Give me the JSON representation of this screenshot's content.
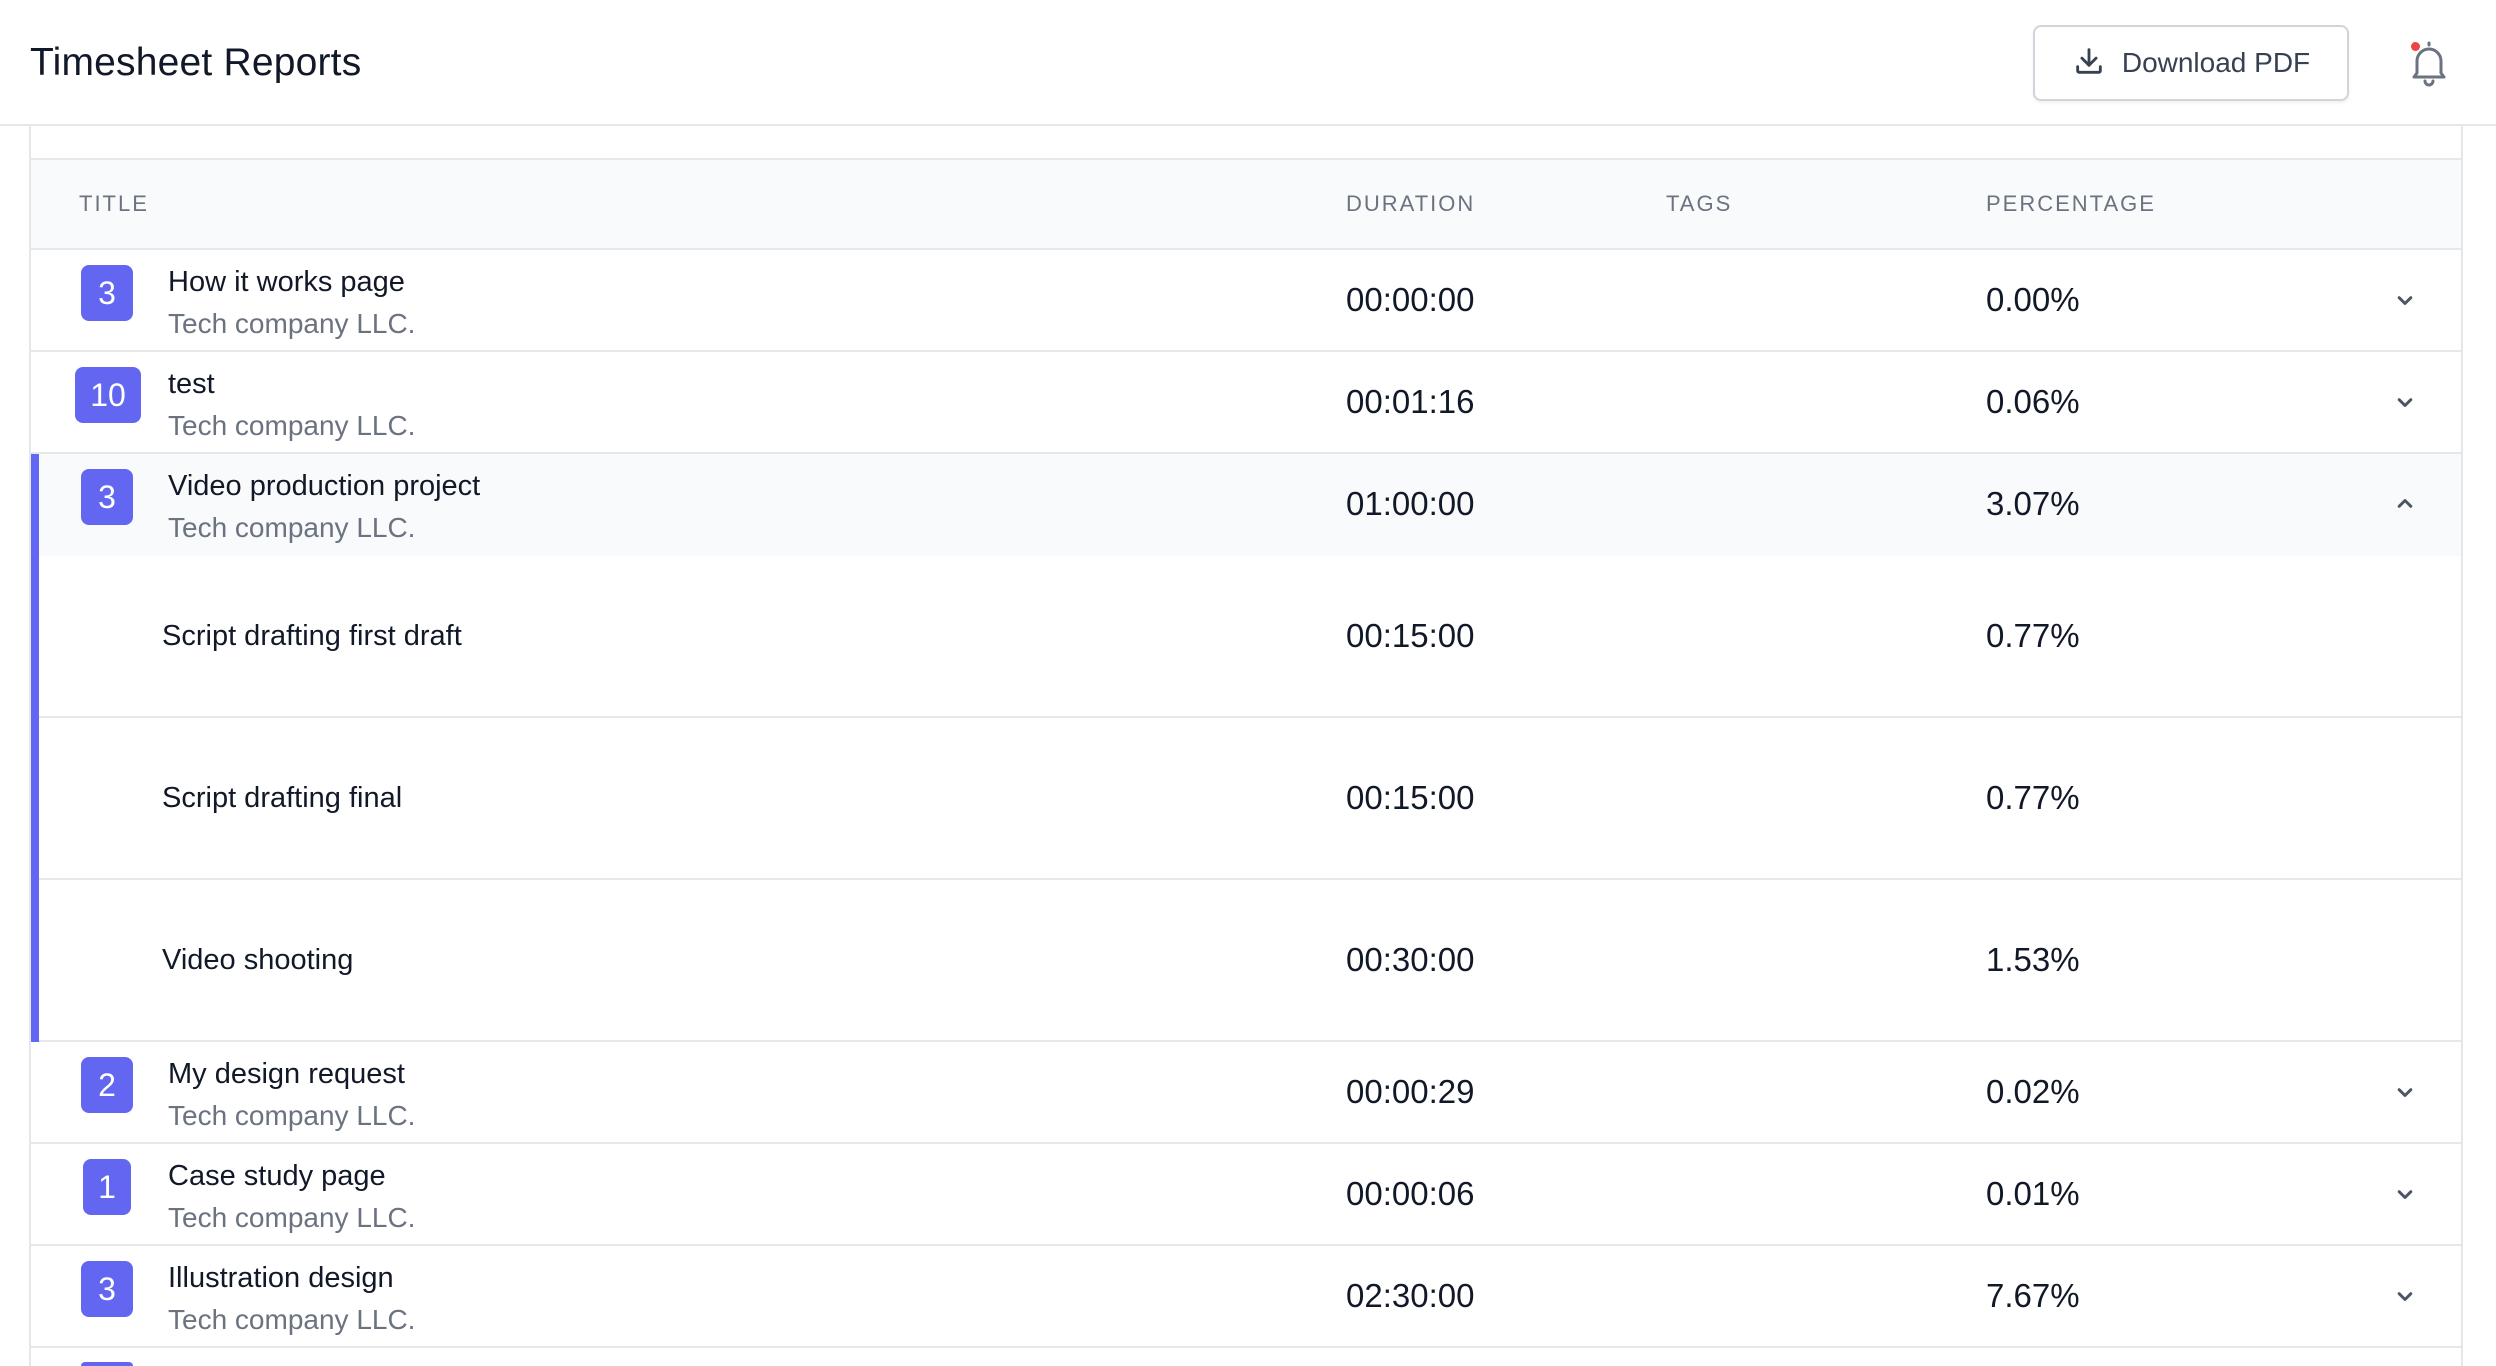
{
  "header": {
    "title": "Timesheet Reports",
    "download_label": "Download PDF",
    "download_icon": "download-icon",
    "bell_icon": "bell-icon",
    "notification_dot_color": "#ef4444"
  },
  "table": {
    "columns": {
      "title": "TITLE",
      "duration": "DURATION",
      "tags": "TAGS",
      "percentage": "PERCENTAGE"
    },
    "accent_color": "#6366f1",
    "rows": [
      {
        "count": "3",
        "title": "How it works page",
        "client": "Tech company LLC.",
        "duration": "00:00:00",
        "percentage": "0.00%",
        "expanded": false
      },
      {
        "count": "10",
        "title": "test",
        "client": "Tech company LLC.",
        "duration": "00:01:16",
        "percentage": "0.06%",
        "expanded": false
      },
      {
        "count": "3",
        "title": "Video production project",
        "client": "Tech company LLC.",
        "duration": "01:00:00",
        "percentage": "3.07%",
        "expanded": true,
        "tasks": [
          {
            "title": "Script drafting first draft",
            "duration": "00:15:00",
            "percentage": "0.77%"
          },
          {
            "title": "Script drafting final",
            "duration": "00:15:00",
            "percentage": "0.77%"
          },
          {
            "title": "Video shooting",
            "duration": "00:30:00",
            "percentage": "1.53%"
          }
        ]
      },
      {
        "count": "2",
        "title": "My design request",
        "client": "Tech company LLC.",
        "duration": "00:00:29",
        "percentage": "0.02%",
        "expanded": false
      },
      {
        "count": "1",
        "title": "Case study page",
        "client": "Tech company LLC.",
        "duration": "00:00:06",
        "percentage": "0.01%",
        "expanded": false
      },
      {
        "count": "3",
        "title": "Illustration design",
        "client": "Tech company LLC.",
        "duration": "02:30:00",
        "percentage": "7.67%",
        "expanded": false
      }
    ]
  }
}
